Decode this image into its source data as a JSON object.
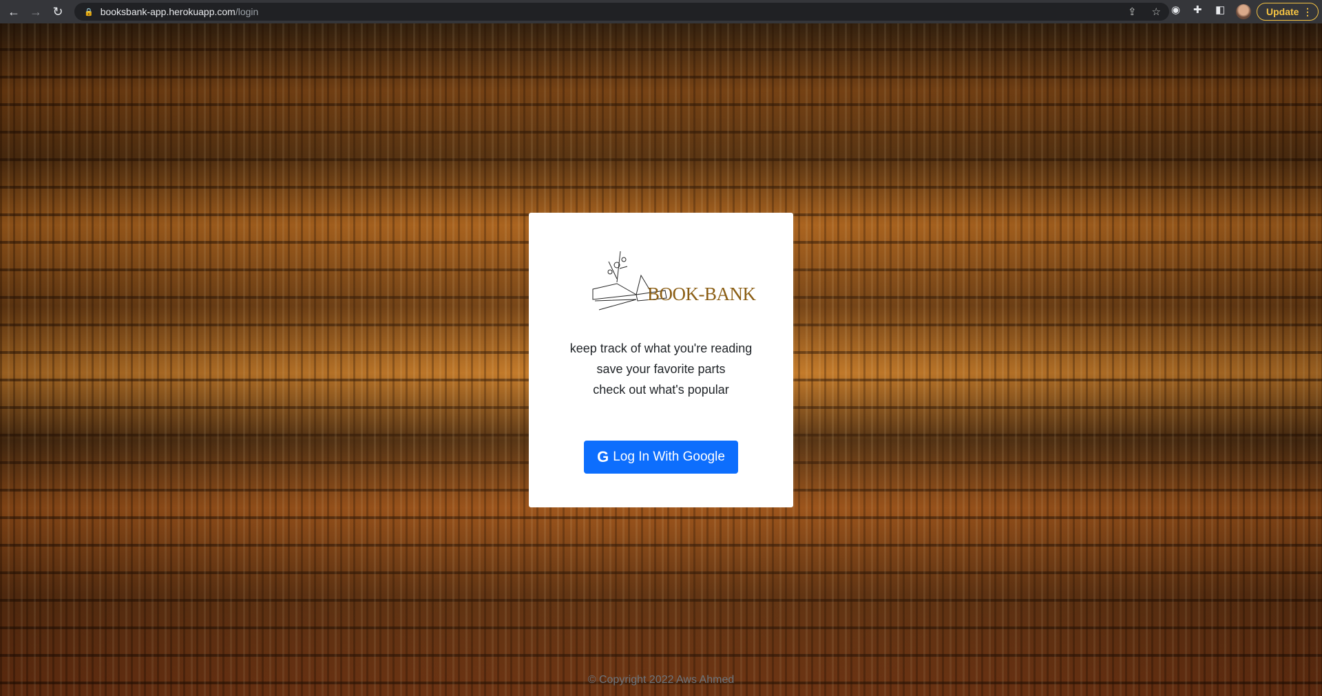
{
  "browser": {
    "url_host": "booksbank-app.herokuapp.com",
    "url_path": "/login",
    "update_label": "Update"
  },
  "card": {
    "brand": "BOOK-BANK",
    "taglines": [
      "keep track of what you're reading",
      "save your favorite parts",
      "check out what's popular"
    ],
    "login_label": "Log In With Google",
    "button_color": "#0d6efd",
    "brand_color": "#8b5e14"
  },
  "footer": {
    "copyright": "© Copyright 2022 Aws Ahmed"
  }
}
